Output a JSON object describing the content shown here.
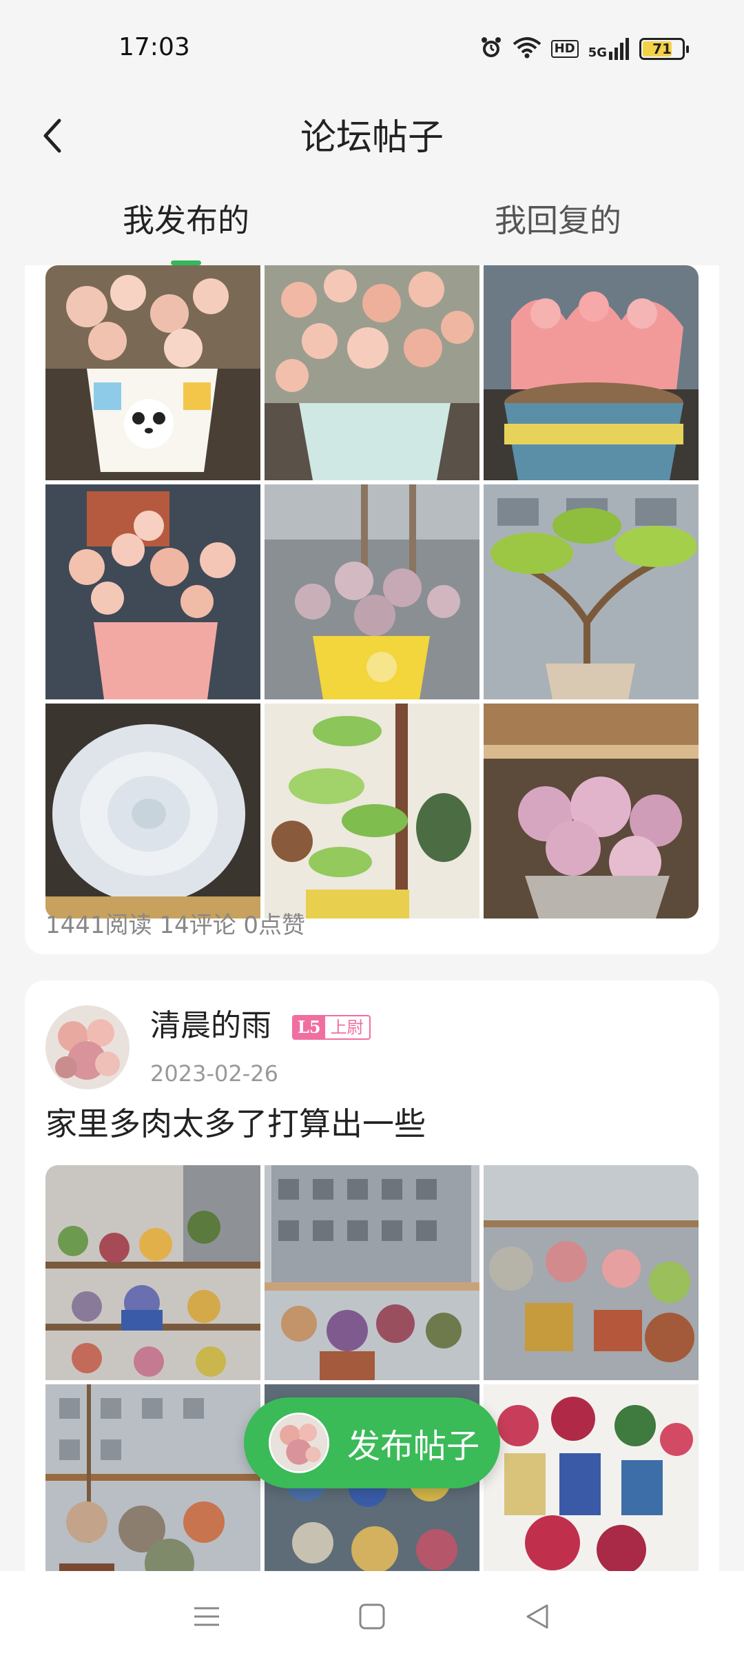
{
  "status_bar": {
    "time": "17:03",
    "icons": [
      "alarm-icon",
      "wifi-icon",
      "hd-icon",
      "5g-signal-icon",
      "battery-icon"
    ],
    "hd_label": "HD",
    "network_label": "5G",
    "battery_level": "71"
  },
  "header": {
    "title": "论坛帖子",
    "back_icon": "chevron-left-icon"
  },
  "tabs": [
    {
      "label": "我发布的",
      "active": true
    },
    {
      "label": "我回复的",
      "active": false
    }
  ],
  "posts": [
    {
      "images": [
        "succulent-panda-pot",
        "succulent-pink-cluster",
        "succulent-pink-rosettes",
        "succulent-pink-pot",
        "succulent-yellow-lemon-pot",
        "jade-plant-bonsai",
        "white-echeveria",
        "green-aeonium",
        "pink-succulent-cluster"
      ],
      "stats": "1441阅读 14评论 0点赞"
    },
    {
      "author": "清晨的雨",
      "level": "L5",
      "rank": "上尉",
      "date": "2023-02-26",
      "title": "家里多肉太多了打算出一些",
      "images": [
        "shelf-succulents",
        "balcony-succulents",
        "potted-succulents",
        "balcony-shelf",
        "blue-pots-shelf",
        "red-succulents"
      ]
    }
  ],
  "fab": {
    "label": "发布帖子"
  },
  "nav_bar": {
    "buttons": [
      "menu-icon",
      "home-square-icon",
      "back-triangle-icon"
    ]
  },
  "colors": {
    "accent": "#3bba58",
    "badge": "#f06ea0"
  }
}
